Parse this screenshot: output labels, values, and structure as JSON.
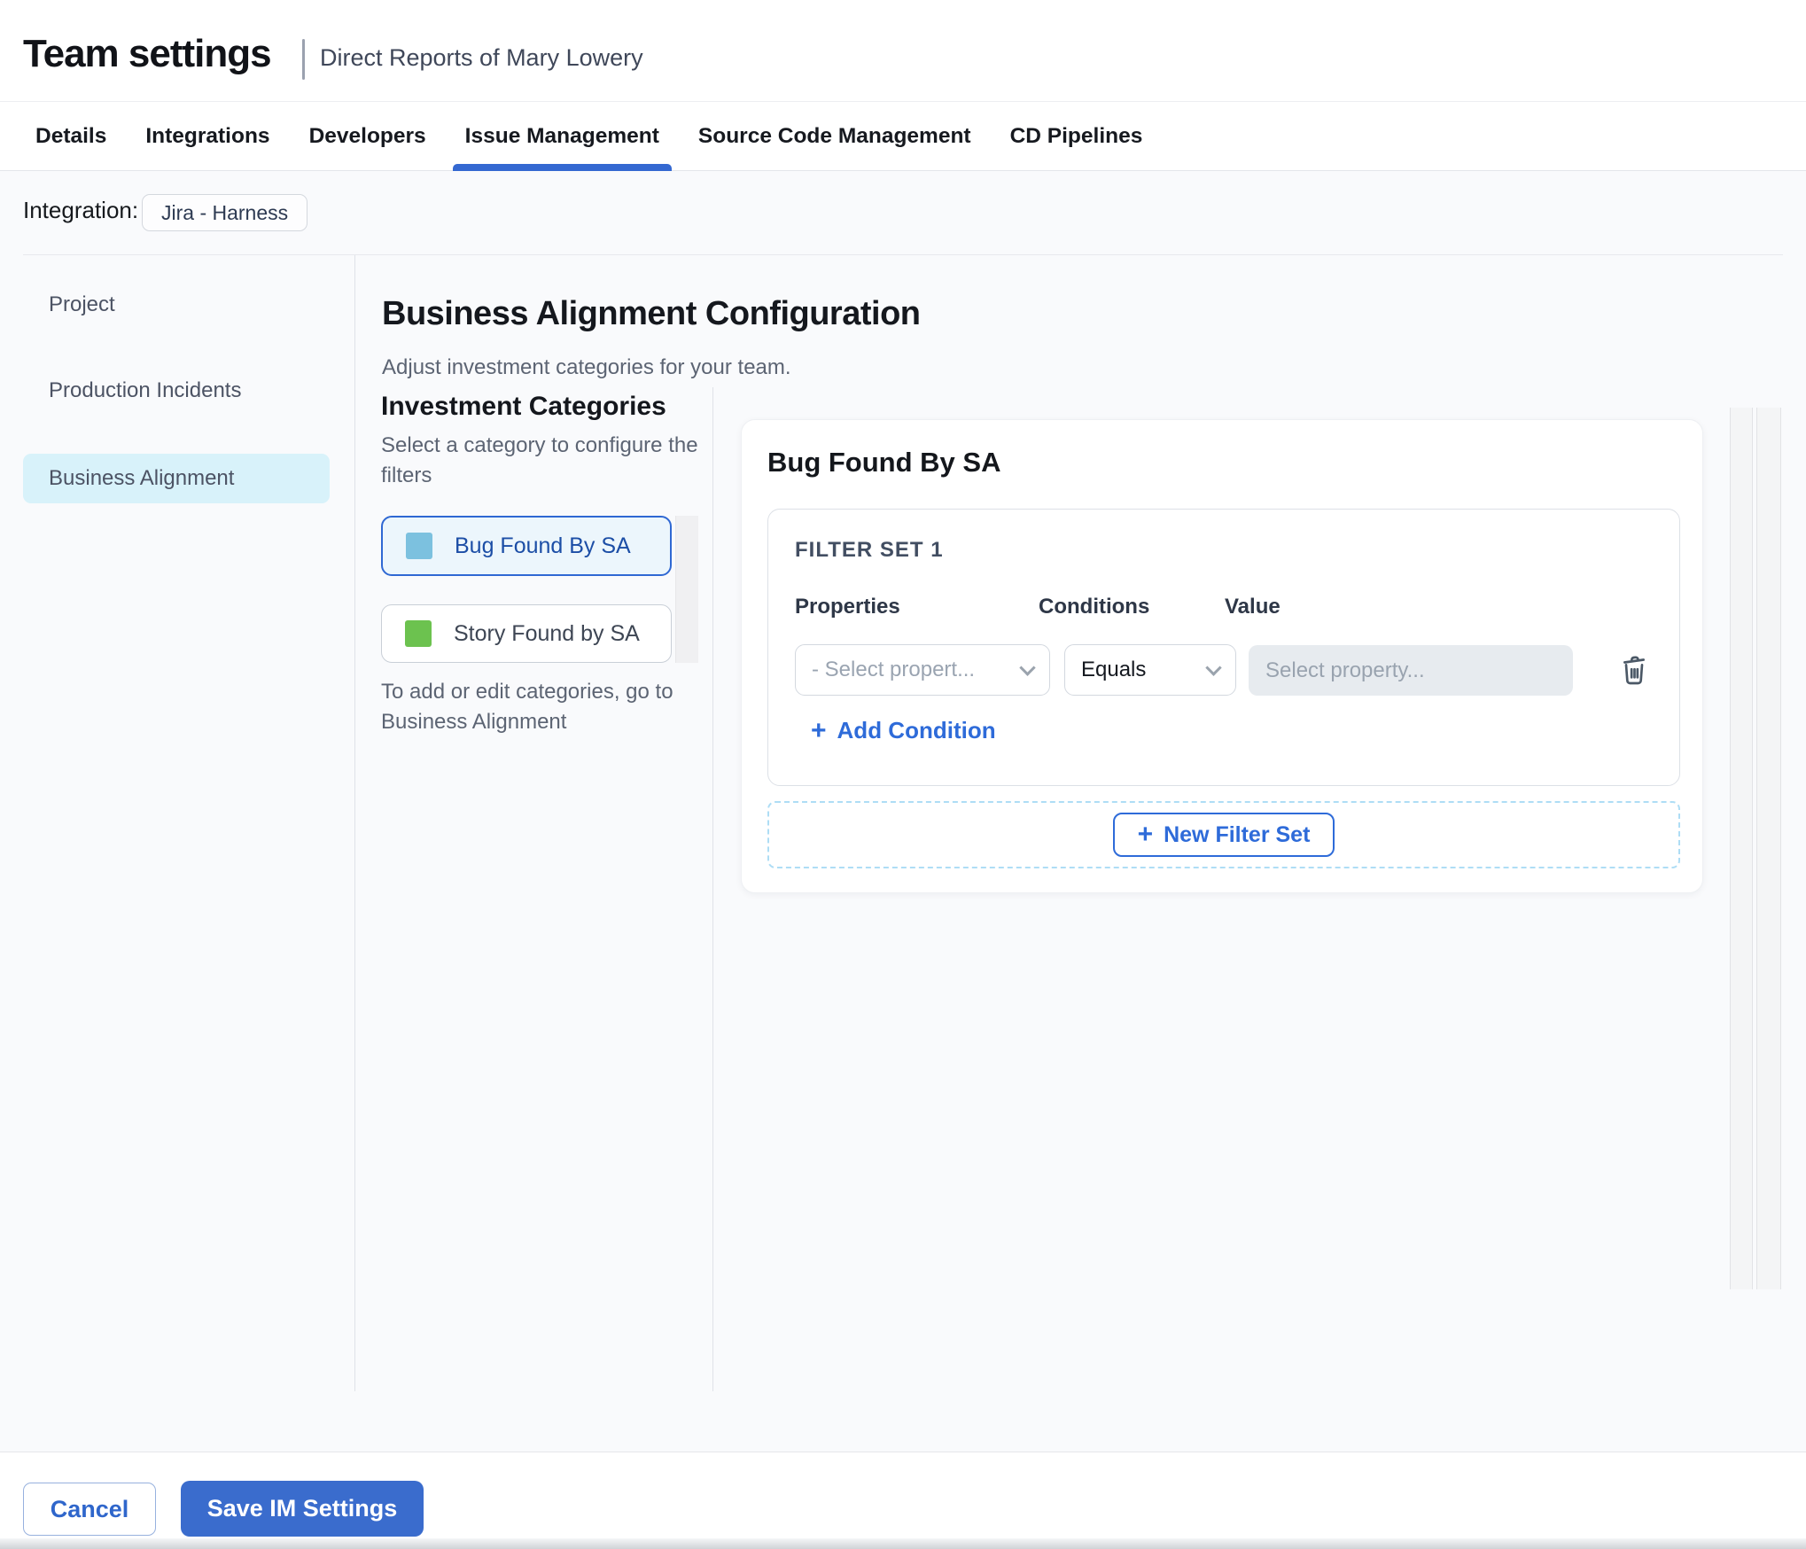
{
  "header": {
    "title": "Team settings",
    "subtitle": "Direct Reports of Mary Lowery"
  },
  "tabs": {
    "active": "Issue Management",
    "items": [
      {
        "label": "Details"
      },
      {
        "label": "Integrations"
      },
      {
        "label": "Developers"
      },
      {
        "label": "Issue Management"
      },
      {
        "label": "Source Code Management"
      },
      {
        "label": "CD Pipelines"
      }
    ]
  },
  "integration": {
    "label": "Integration:",
    "chip": "Jira - Harness"
  },
  "sidebar": {
    "selected": "Business Alignment",
    "items": [
      {
        "label": "Project"
      },
      {
        "label": "Production Incidents"
      },
      {
        "label": "Business Alignment"
      }
    ]
  },
  "main": {
    "title": "Business Alignment Configuration",
    "subtitle": "Adjust investment categories for your team.",
    "categories": {
      "title": "Investment Categories",
      "hint": "Select a category to configure the filters",
      "note": "To add or edit categories, go to Business Alignment",
      "items": [
        {
          "label": "Bug Found By SA",
          "swatch_color": "#7CC1DF",
          "selected": true
        },
        {
          "label": "Story Found by SA",
          "swatch_color": "#6CC24F",
          "selected": false
        }
      ]
    },
    "panel": {
      "title": "Bug Found By SA",
      "filter_set": {
        "label": "FILTER SET 1",
        "columns": [
          "Properties",
          "Conditions",
          "Value"
        ],
        "property_placeholder": "- Select propert...",
        "condition_value": "Equals",
        "value_placeholder": "Select property...",
        "add_condition_label": "Add Condition"
      },
      "new_filter_set_label": "New Filter Set"
    }
  },
  "footer": {
    "cancel_label": "Cancel",
    "save_label": "Save IM Settings"
  },
  "colors": {
    "accent_blue": "#3468D1",
    "link_blue": "#2E6BD9",
    "save_button_bg": "#3A6CCD",
    "selected_nav_bg": "#D8F2FA",
    "selected_category_bg": "#ECF6FC",
    "bug_swatch": "#7CC1DF",
    "story_swatch": "#6CC24F",
    "content_bg": "#F9FAFC"
  }
}
